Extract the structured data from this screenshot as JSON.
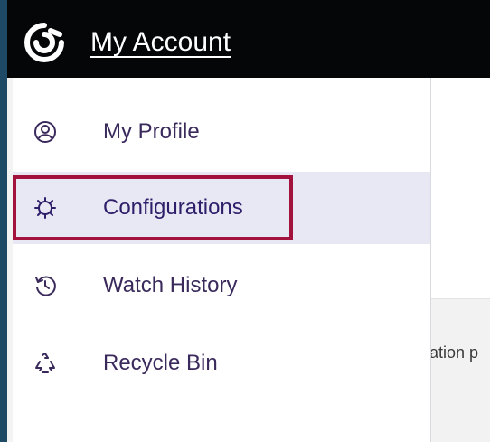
{
  "header": {
    "title": "My Account"
  },
  "menu": {
    "items": [
      {
        "label": "My Profile",
        "icon": "user-circle-icon"
      },
      {
        "label": "Configurations",
        "icon": "gear-icon",
        "selected": true
      },
      {
        "label": "Watch History",
        "icon": "history-icon"
      },
      {
        "label": "Recycle Bin",
        "icon": "recycle-icon"
      }
    ]
  },
  "background": {
    "partial_text": "cation p"
  },
  "colors": {
    "topbar": "#050608",
    "accent_border": "#a3123c",
    "menu_text": "#3a2a5c",
    "selected_bg": "#e8e8f4",
    "rail": "#1f4a66"
  }
}
